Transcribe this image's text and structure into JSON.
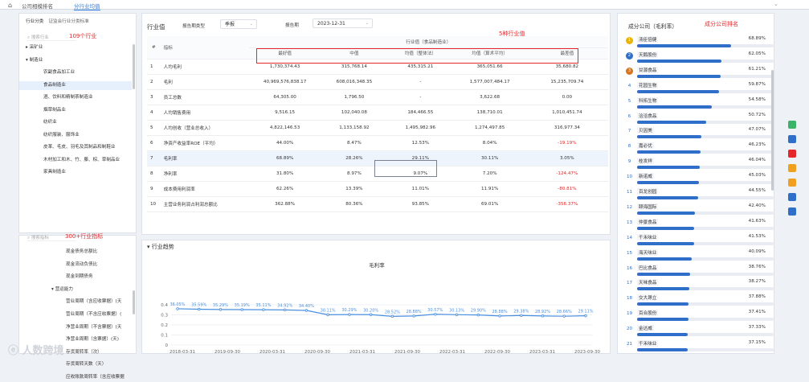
{
  "topbar": {
    "tab1": "公司相模排名",
    "tab2": "分行业均值"
  },
  "left": {
    "tab1": "行业分类",
    "tab2": "证监会行业分类标准",
    "search": "搜索行业",
    "note": "109个行业",
    "items": [
      {
        "t": "▸ 采矿业",
        "ind": 0
      },
      {
        "t": "▾ 制造业",
        "ind": 0
      },
      {
        "t": "农副食品加工业",
        "ind": 1
      },
      {
        "t": "食品制造业",
        "ind": 1
      },
      {
        "t": "酒、饮料和精制茶制造业",
        "ind": 1
      },
      {
        "t": "烟草制品业",
        "ind": 1
      },
      {
        "t": "纺织业",
        "ind": 1
      },
      {
        "t": "纺织服装、服饰业",
        "ind": 1
      },
      {
        "t": "皮革、毛皮、羽毛及其制品和制鞋业",
        "ind": 1
      },
      {
        "t": "木材加工和木、竹、藤、棕、草制品业",
        "ind": 1
      },
      {
        "t": "家具制造业",
        "ind": 1
      }
    ],
    "selected_index": 3
  },
  "left2": {
    "search": "搜索指标",
    "note": "300+行业指标",
    "items": [
      {
        "t": "现金债务总额比",
        "ind": 2
      },
      {
        "t": "现金流动负债比",
        "ind": 2
      },
      {
        "t": "现金到期债务",
        "ind": 2
      },
      {
        "t": "▾ 营运能力",
        "ind": 1
      },
      {
        "t": "营业周期（含应收票据）(天",
        "ind": 2
      },
      {
        "t": "营业周期（不含应收票据）(",
        "ind": 2
      },
      {
        "t": "净营业周期（不含票据）(天",
        "ind": 2
      },
      {
        "t": "净营业周期（含票据）(天)",
        "ind": 2
      },
      {
        "t": "存货周转率（次）",
        "ind": 2
      },
      {
        "t": "存货周转天数（天）",
        "ind": 2
      },
      {
        "t": "应收账款周转率（含应收票据",
        "ind": 2
      }
    ]
  },
  "main": {
    "title": "行业值",
    "report_type_label": "报告期类型",
    "report_type": "季报",
    "period_label": "报告期",
    "period": "2023-12-31",
    "note": "5种行业值",
    "group_header": "行业值（食品制造业）",
    "columns": [
      "#",
      "指标",
      "最好值",
      "中值",
      "均值（整体法）",
      "均值（算术平均）",
      "最差值"
    ],
    "rows": [
      [
        "1",
        "人均毛利",
        "1,730,374.43",
        "315,768.14",
        "435,315.21",
        "365,051.66",
        "35,680.82"
      ],
      [
        "2",
        "毛利",
        "40,969,576,838.17",
        "608,016,348.35",
        "-",
        "1,577,007,484.17",
        "15,235,709.74"
      ],
      [
        "3",
        "员工总数",
        "64,305.00",
        "1,796.50",
        "-",
        "3,622.68",
        "0.00"
      ],
      [
        "4",
        "人均销售费用",
        "9,516.15",
        "102,040.08",
        "184,466.55",
        "138,710.01",
        "1,010,451.74"
      ],
      [
        "5",
        "人均创收（营业总收入）",
        "4,822,146.53",
        "1,133,158.92",
        "1,495,982.96",
        "1,274,497.85",
        "316,977.34"
      ],
      [
        "6",
        "净资产收益率ROE（平均）",
        "44.00%",
        "8.47%",
        "12.53%",
        "8.04%",
        "-19.19%"
      ],
      [
        "7",
        "毛利率",
        "68.89%",
        "28.26%",
        "29.11%",
        "30.11%",
        "3.05%"
      ],
      [
        "8",
        "净利率",
        "31.80%",
        "8.97%",
        "9.07%",
        "7.20%",
        "-124.47%"
      ],
      [
        "9",
        "成本费用利润率",
        "62.26%",
        "13.39%",
        "11.01%",
        "11.91%",
        "-80.81%"
      ],
      [
        "10",
        "主营业务利润占利润总额比",
        "362.88%",
        "80.36%",
        "93.85%",
        "69.01%",
        "-356.37%"
      ]
    ],
    "negatives": [
      "-19.19%",
      "-124.47%",
      "-80.81%",
      "-356.37%"
    ]
  },
  "trend": {
    "title": "行业趋势",
    "chart_title": "毛利率"
  },
  "chart_data": {
    "type": "line",
    "title": "毛利率",
    "xlabel": "",
    "ylabel": "",
    "x": [
      "2018-03-31",
      "2018-06-30",
      "2018-09-30",
      "2018-12-31",
      "2019-03-31",
      "2019-06-30",
      "2019-09-30",
      "2019-12-31",
      "2020-03-31",
      "2020-06-30",
      "2020-09-30",
      "2020-12-31",
      "2021-03-31",
      "2021-06-30",
      "2021-09-30",
      "2021-12-31",
      "2022-03-31",
      "2022-06-30",
      "2022-09-30",
      "2022-12-31",
      "2023-03-31",
      "2023-06-30",
      "2023-09-30",
      "2023-12-31"
    ],
    "xticks": [
      "2018-03-31",
      "2019-09-30",
      "2020-03-31",
      "2020-09-30",
      "2021-03-31",
      "2021-09-30",
      "2022-03-31",
      "2022-09-30",
      "2023-03-31",
      "2023-09-30"
    ],
    "values": [
      0.3605,
      0.3559,
      0.3529,
      0.3519,
      0.3511,
      0.3492,
      0.344,
      0.3011,
      0.3029,
      0.302,
      0.2852,
      0.2888,
      0.3057,
      0.3013,
      0.299,
      0.2888,
      0.2938,
      0.2892,
      0.2866,
      0.2911
    ],
    "labels": [
      "36.05%",
      "35.59%",
      "35.29%",
      "35.19%",
      "35.11%",
      "34.92%",
      "34.40%",
      "30.11%",
      "30.29%",
      "30.20%",
      "28.52%",
      "28.88%",
      "30.57%",
      "30.13%",
      "29.90%",
      "28.88%",
      "29.38%",
      "28.92%",
      "28.66%",
      "29.11%"
    ],
    "yticks": [
      "0.4",
      "0.3",
      "0.2",
      "0.1",
      "0"
    ],
    "ylim": [
      0,
      0.4
    ]
  },
  "right": {
    "title": "成分公司（毛利率）",
    "note": "成分公司排名",
    "items": [
      {
        "n": "汤臣倍健",
        "p": "68.89%",
        "v": 68.89
      },
      {
        "n": "天鹅股份",
        "p": "62.05%",
        "v": 62.05
      },
      {
        "n": "甘源食品",
        "p": "61.21%",
        "v": 61.21
      },
      {
        "n": "花园生物",
        "p": "59.87%",
        "v": 59.87
      },
      {
        "n": "科拓生物",
        "p": "54.58%",
        "v": 54.58
      },
      {
        "n": "洽洽食品",
        "p": "50.72%",
        "v": 50.72
      },
      {
        "n": "贝因美",
        "p": "47.07%",
        "v": 47.07
      },
      {
        "n": "嘉必优",
        "p": "46.23%",
        "v": 46.23
      },
      {
        "n": "桂发祥",
        "p": "46.04%",
        "v": 46.04
      },
      {
        "n": "新诺威",
        "p": "45.03%",
        "v": 45.03
      },
      {
        "n": "百龙创园",
        "p": "44.55%",
        "v": 44.55
      },
      {
        "n": "颐海国际",
        "p": "42.40%",
        "v": 42.4
      },
      {
        "n": "仲景食品",
        "p": "41.63%",
        "v": 41.63
      },
      {
        "n": "千禾味业",
        "p": "41.53%",
        "v": 41.53
      },
      {
        "n": "海天味业",
        "p": "40.09%",
        "v": 40.09
      },
      {
        "n": "巴比食品",
        "p": "38.76%",
        "v": 38.76
      },
      {
        "n": "天味食品",
        "p": "38.27%",
        "v": 38.27
      },
      {
        "n": "交大昂立",
        "p": "37.88%",
        "v": 37.88
      },
      {
        "n": "百合股份",
        "p": "37.41%",
        "v": 37.41
      },
      {
        "n": "金达威",
        "p": "37.33%",
        "v": 37.33
      },
      {
        "n": "千禾味业",
        "p": "37.15%",
        "v": 37.15
      }
    ]
  },
  "watermark": "ⓔ 人数跨境",
  "colors": {
    "accent": "#2f6fc9",
    "red": "#e5262b",
    "line": "#4a90e2"
  }
}
